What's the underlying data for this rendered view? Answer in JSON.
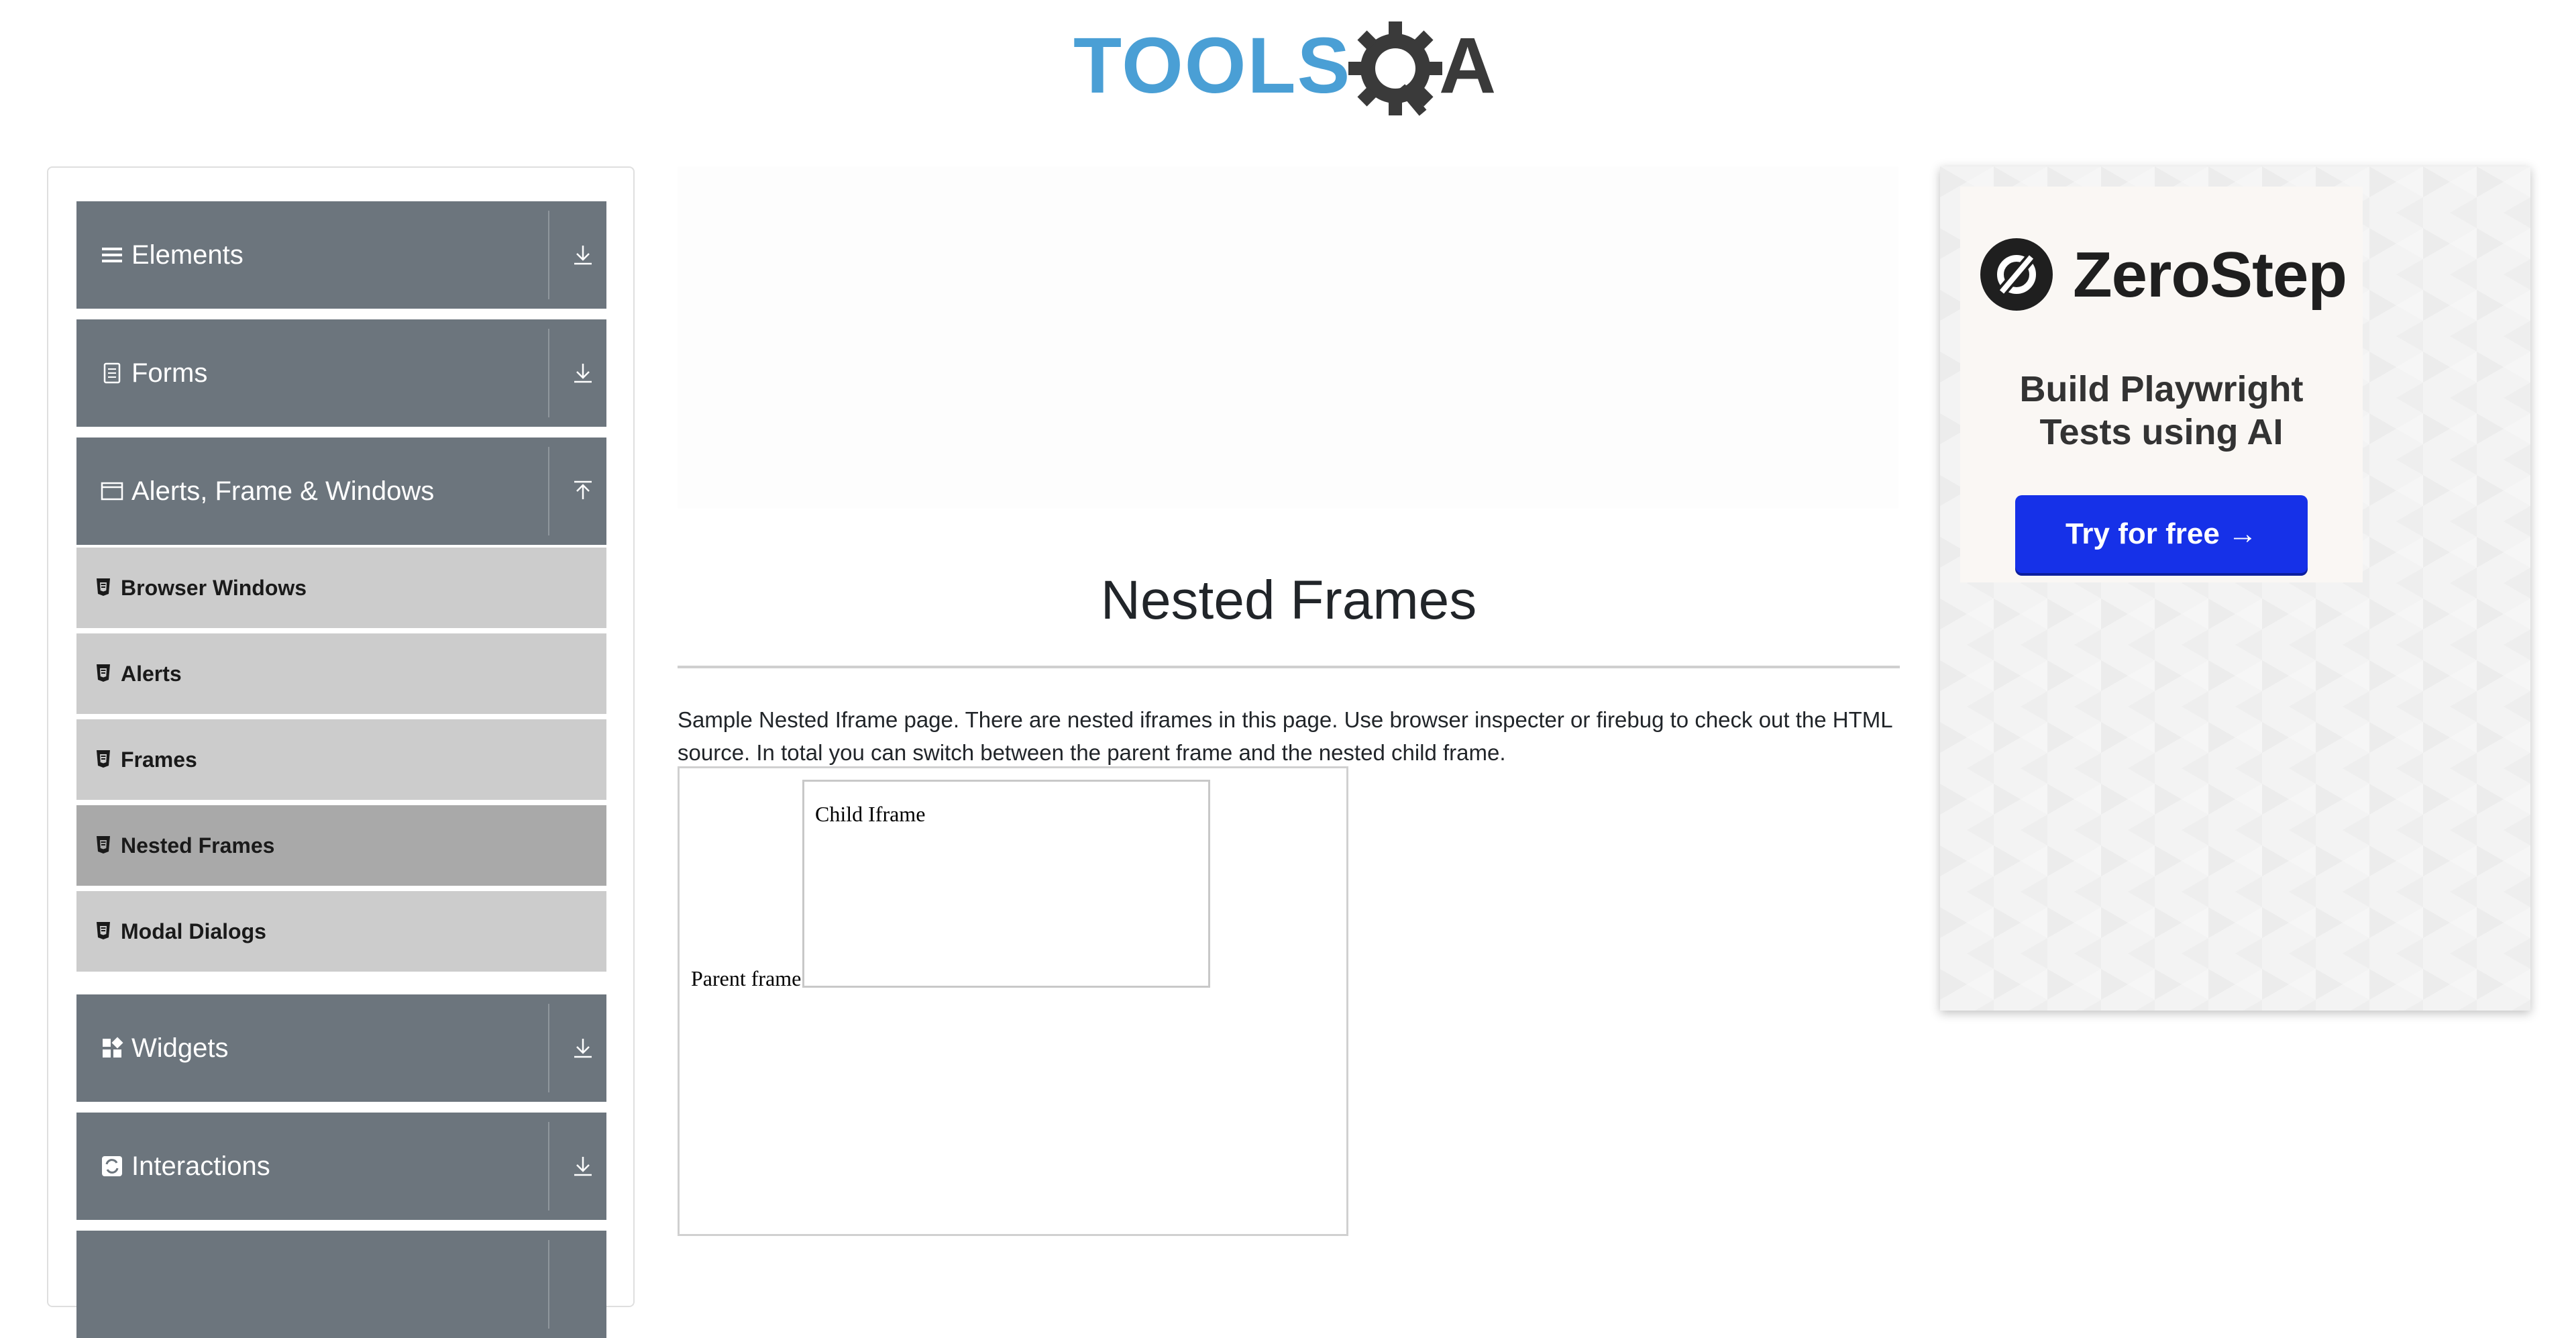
{
  "header": {
    "logo_text_left": "TOOLS",
    "logo_text_right": "A"
  },
  "sidebar": {
    "groups_top": [
      {
        "label": "Elements",
        "icon": "hamburger-icon",
        "arrow": "download-icon"
      },
      {
        "label": "Forms",
        "icon": "document-icon",
        "arrow": "download-icon"
      },
      {
        "label": "Alerts, Frame & Windows",
        "icon": "window-icon",
        "arrow": "upload-icon"
      }
    ],
    "subitems": [
      {
        "label": "Browser Windows",
        "active": false
      },
      {
        "label": "Alerts",
        "active": false
      },
      {
        "label": "Frames",
        "active": false
      },
      {
        "label": "Nested Frames",
        "active": true
      },
      {
        "label": "Modal Dialogs",
        "active": false
      }
    ],
    "groups_bottom": [
      {
        "label": "Widgets",
        "icon": "widgets-icon",
        "arrow": "download-icon"
      },
      {
        "label": "Interactions",
        "icon": "interactions-icon",
        "arrow": "download-icon"
      },
      {
        "label": "",
        "icon": "",
        "arrow": ""
      }
    ]
  },
  "main": {
    "title": "Nested Frames",
    "description": "Sample Nested Iframe page. There are nested iframes in this page. Use browser inspecter or firebug to check out the HTML source. In total you can switch between the parent frame and the nested child frame.",
    "parent_frame_text": "Parent frame",
    "child_frame_text": "Child Iframe"
  },
  "ad": {
    "brand": "ZeroStep",
    "headline_line1": "Build Playwright",
    "headline_line2": "Tests using AI",
    "cta": "Try for free →",
    "cta_color": "#1631e8"
  },
  "colors": {
    "group_bg": "#6c757d",
    "subitem_bg": "#cccccc",
    "subitem_active_bg": "#a9a9a9",
    "logo_blue": "#4a9fd5",
    "logo_dark": "#3a3a3a"
  }
}
